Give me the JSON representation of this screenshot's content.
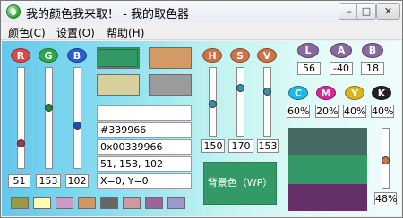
{
  "window": {
    "title": "我的颜色我来取！ - 我的取色器",
    "controls": {
      "minimize": "–",
      "maximize": "□",
      "close": "✕"
    }
  },
  "menu": [
    "颜色(C)",
    "设置(O)",
    "帮助(H)"
  ],
  "rgb": {
    "labels": [
      "R",
      "G",
      "B"
    ],
    "colors": [
      "#d94a4a",
      "#2fa84a",
      "#2b5fd0"
    ],
    "values": [
      "51",
      "153",
      "102"
    ]
  },
  "hsv": {
    "labels": [
      "H",
      "S",
      "V"
    ],
    "values": [
      "150",
      "170",
      "153"
    ]
  },
  "lab": {
    "labels": [
      "L",
      "A",
      "B"
    ],
    "values": [
      "56",
      "-40",
      "18"
    ]
  },
  "cmyk": {
    "labels": [
      "C",
      "M",
      "Y",
      "K"
    ],
    "colors": [
      "#21b6e3",
      "#d8259a",
      "#d7b51b",
      "#222222"
    ],
    "values": [
      "60%",
      "20%",
      "40%",
      "40%"
    ]
  },
  "info": {
    "line1": "",
    "hex": "#339966",
    "hex_value": "0x00339966",
    "rgb_text": "51, 153, 102",
    "coords": "X=0, Y=0"
  },
  "background_button": "背景色（WP）",
  "brightness_percent": "48%",
  "swatches": {
    "main": [
      "#339966",
      "#d39a66",
      "#d8d09c",
      "#9b9b9b"
    ],
    "recent": [
      "#9a9a42",
      "#ffffb0",
      "#cc99cc",
      "#cc9966",
      "#666666",
      "#cc99a0",
      "#996699",
      "#9999cc"
    ],
    "stack": [
      "#466a64",
      "#339966",
      "#65306a"
    ]
  }
}
